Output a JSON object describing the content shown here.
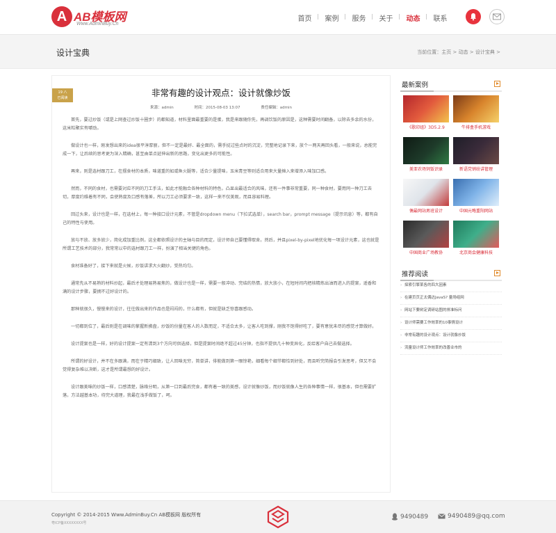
{
  "header": {
    "logo_mark": "A",
    "logo_text": "AB模板网",
    "logo_site": "Www.AdminBuy.Cn",
    "nav": [
      "首页",
      "案例",
      "服务",
      "关于",
      "动态",
      "联系"
    ],
    "active_nav": "动态",
    "icons": {
      "bell": "bell-icon",
      "mail": "mail-icon"
    }
  },
  "banner": {
    "title": "设计宝典",
    "breadcrumb": "当前位置：主页 > 动态 > 设计宝典 >"
  },
  "article": {
    "date_tag": {
      "line1": "19 八",
      "line2": "已阅读"
    },
    "title": "非常有趣的设计观点：设计就像炒饭",
    "meta": {
      "author": "来源：admin",
      "time": "时间：2015-08-03 13:07",
      "editor": "责任编辑：admin"
    },
    "paragraphs": [
      "首先，要过炒饭（或是上网查过炒饭十圈步）的都知道，材料里面最重要的是蛋，我是来跟随你先，再调饮饭的原因是，这种需要时间翻备，以除去多余的水份，这米粒聚实有嚼劲。",
      "做设计也一样，刚发想出来的idea很平淳厚丽，但不一定是最好、最全面的，需手挝过些点时的沉淀，完整地记录下来，放个一两天再回头看，一般来说，总能完成一下，让后续的思考更为深入精确，甚至由单点延伸出新的思路，变化出更多的可能性。",
      "再来，则是选材跟刀工，在摆食材的本质，味道重的如咸鱼火腿等，适合少量提味，玉米青豆等则适合用来大量摊入来增添入味加口感。",
      "然而，不同的食材，也需要对应不同的刀工手法，如此才能融合各种材料的特色，凸显出最适合的风味，还有一件事非常重要，同一种食材，要用同一种刀工去切，厚度约维着有不同，会使熟度及口感有落差，所以刀工必须要求一致，这样一来不仅美观，而且容易料理。",
      "回过头来，设计也是一样，在选材上，每一种接口设计元素，不管是dropdown menu（下拉式选单），search bar，prompt message（提示讯息）等，都有自己的特性与使用。",
      "放与不放、放多放少，简化成加重比例，这全都依照设计的主轴与目的而定，设计师自己要懂得取舍。然后，并且pixel-by-pixel地优化每一项设计元素，这也就是所谓工艺技术的部分，我常常以中的选材跟刀工一样，扮演了相当关键的角色。",
      "食材准备好了，接下来就是火候，炒饭讲求大火翻炒，受热均匀。",
      "通常先从不易熟的材料炒起，最后才处理易熟易焦的，做设计也是一样，需要一般冲动、完结的热情，放大放小，在短时间内把核精炼出油而进入的提案，遥香和满的设计步骤，要拥不过好设计的。",
      "那种就很久，慢慢来的设计，往往做出来的作品也是闷闷的，什么都有，但就是缺乏惊喜跟感动。",
      "一切都到位了，最后则是在调味的掌握新拂盘，炒饭的份量在客人的人数而定，不适合太多，让客人吃到撑，刚我不饱得好吃了，要有意犹未尽的感觉才算做好。",
      "设计提案也是一样，好的设计提案一定有清到3个方向可供选择，但是提案时间绝不超过45分钟，也指不提供几十种变异化，反给客户自己去做选择。",
      "所谓的好设计，并不在多跟满，而在于精巧细致，让人回味无穷，简单讲，俳能做到第一眼惊艳，细看每个细节都恰到好处，而且听完简报会引发思考，但又不会觉得复杂难以决断，这才是所谓最想的好设计。",
      "设计跟美味的炒饭一样，口感清楚，脉络分明，从第一口到最后完食，都有着一致的美感，设计就像炒饭，而炒饭就像人生的各种事情一样，很基本，但也需要扩落，方法越基本功，待完大道理，我最在浅手做饭了，呵。"
    ]
  },
  "sidebar": {
    "cases_title": "最新案例",
    "cases": [
      "《歌印组》3D5.2.9",
      "牛排盒手机游戏",
      "美亚农场饲饭识录",
      "新语党销纷讲管理",
      "偶最网站男班设计",
      "中国元略重阳网站",
      "中国商业广场教协",
      "北京商会健康科技"
    ],
    "reads_title": "推荐阅读",
    "reads": [
      "探索引擎某各的四大因素",
      "在建页页正太偶达JavaS? 量场组网",
      "网站下要树定调研站图的排准标问",
      "设计师需要工作效率的10事情设计",
      "非常有趣的设计观点：设计就像炒饭",
      "流量设计师工作效率的改善业市的"
    ],
    "more_icon": "more-arrow-icon"
  },
  "footer": {
    "copyright": "Copyright © 2014-2015 Www.AdminBuy.Cn AB模板网 版权所有",
    "icp": "粤ICP备XXXXXXXX号",
    "qq": "9490489",
    "email": "9490489@qq.com"
  },
  "colors": {
    "brand_red": "#d9303b",
    "gold_tag": "#c9a24a",
    "footer_bg": "#f2f2f2",
    "banner_bg": "#f4f4f4"
  }
}
